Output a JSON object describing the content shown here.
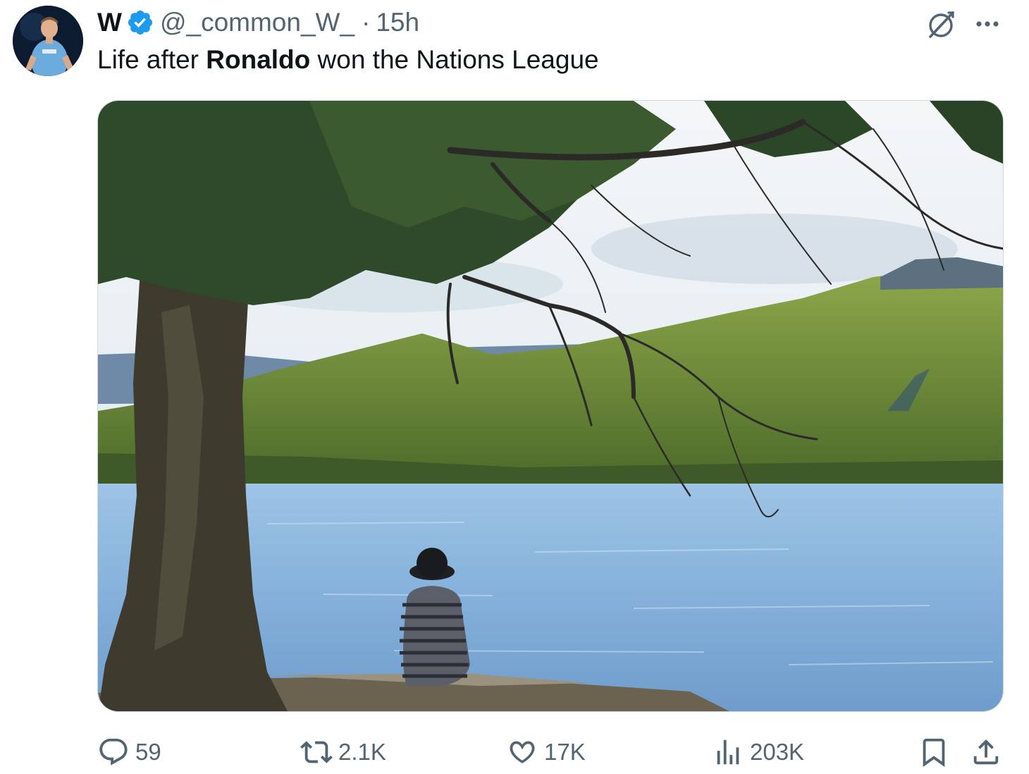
{
  "tweet": {
    "author_name": "W",
    "handle": "@_common_W_",
    "separator": "·",
    "time": "15h",
    "text_before": "Life after ",
    "text_bold": "Ronaldo",
    "text_after": " won the Nations League"
  },
  "metrics": {
    "replies": "59",
    "reposts": "2.1K",
    "likes": "17K",
    "views": "203K"
  },
  "colors": {
    "verified_blue": "#1d9bf0",
    "secondary_text": "#536471",
    "primary_text": "#0f1419"
  },
  "icons": {
    "verified": "verified-badge-icon",
    "grok": "grok-icon",
    "more": "more-options-icon",
    "reply": "reply-icon",
    "repost": "repost-icon",
    "like": "like-icon",
    "views": "views-icon",
    "bookmark": "bookmark-icon",
    "share": "share-icon"
  }
}
